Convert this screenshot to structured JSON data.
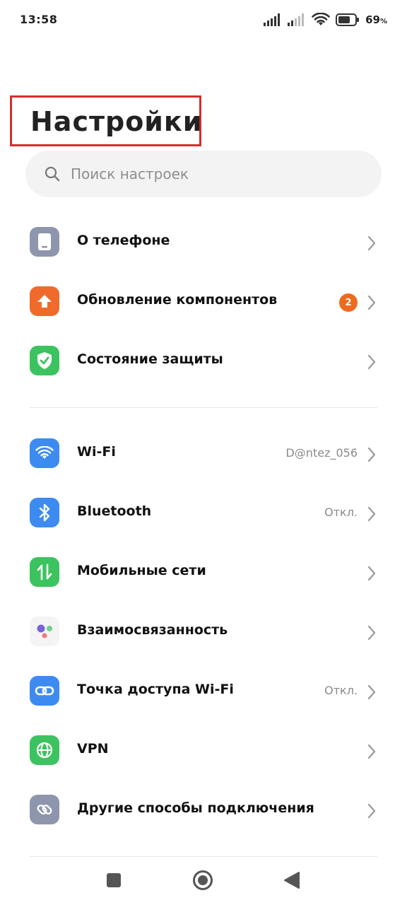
{
  "status_bar": {
    "time": "13:58",
    "battery_percent": "69",
    "battery_unit": "%",
    "icons": [
      "signal-icon",
      "signal-icon-2",
      "wifi-icon",
      "battery-icon"
    ]
  },
  "header": {
    "title": "Настройки"
  },
  "search": {
    "placeholder": "Поиск настроек",
    "value": ""
  },
  "group1": [
    {
      "label": "О телефоне",
      "icon": "phone-icon",
      "color": "#8e96ae"
    },
    {
      "label": "Обновление компонентов",
      "icon": "upload-arrow-icon",
      "color": "#f06a2c",
      "badge": "2"
    },
    {
      "label": "Состояние защиты",
      "icon": "shield-check-icon",
      "color": "#3cc35f"
    }
  ],
  "group2": [
    {
      "label": "Wi-Fi",
      "value": "D@ntez_056",
      "icon": "wifi-icon",
      "color": "#3d8bf0"
    },
    {
      "label": "Bluetooth",
      "value": "Откл.",
      "icon": "bluetooth-icon",
      "color": "#3d8bf0"
    },
    {
      "label": "Мобильные сети",
      "icon": "mobile-data-icon",
      "color": "#3cc35f"
    },
    {
      "label": "Взаимосвязанность",
      "icon": "interconnect-dots-icon",
      "color": "#f4f4f4"
    },
    {
      "label": "Точка доступа Wi-Fi",
      "value": "Откл.",
      "icon": "hotspot-link-icon",
      "color": "#3d8bf0"
    },
    {
      "label": "VPN",
      "icon": "globe-icon",
      "color": "#3cc35f"
    },
    {
      "label": "Другие способы подключения",
      "icon": "link-icon",
      "color": "#8e96ae"
    }
  ],
  "nav": {
    "buttons": [
      "recents-square-icon",
      "home-circle-icon",
      "back-triangle-icon"
    ]
  }
}
